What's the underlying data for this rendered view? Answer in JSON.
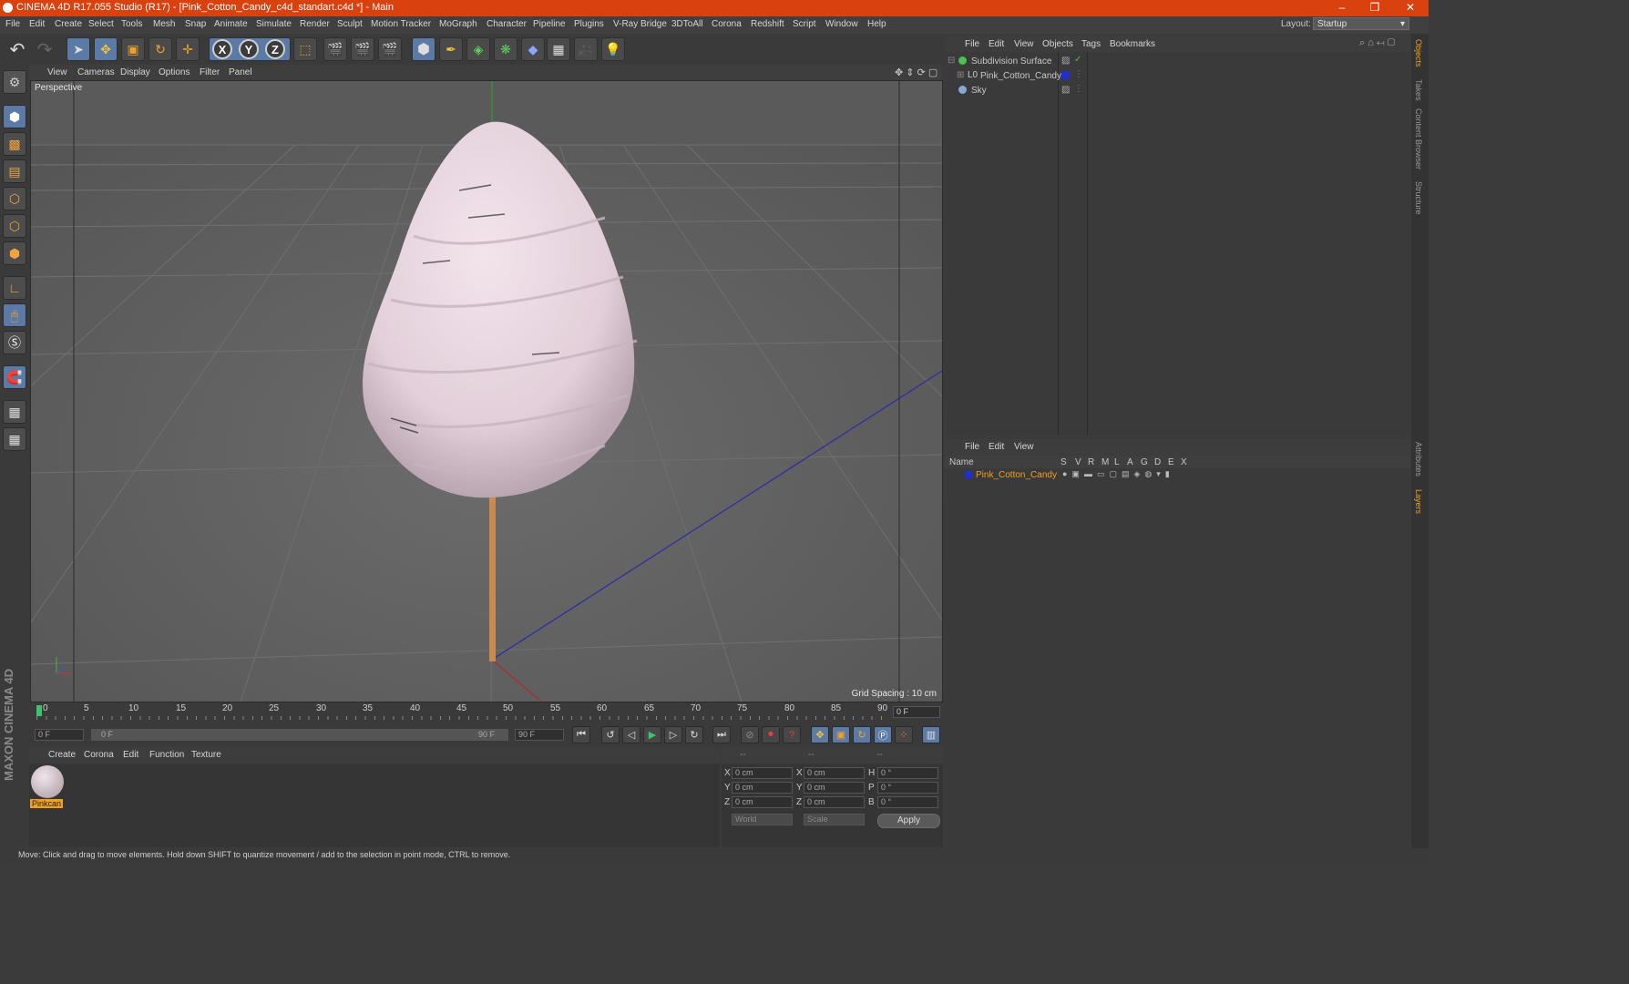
{
  "window": {
    "title": "CINEMA 4D R17.055 Studio (R17) - [Pink_Cotton_Candy_c4d_standart.c4d *] - Main",
    "minimize": "–",
    "restore": "❐",
    "close": "✕"
  },
  "menubar": {
    "items": [
      "File",
      "Edit",
      "Create",
      "Select",
      "Tools",
      "Mesh",
      "Snap",
      "Animate",
      "Simulate",
      "Render",
      "Sculpt",
      "Motion Tracker",
      "MoGraph",
      "Character",
      "Pipeline",
      "Plugins",
      "V-Ray Bridge",
      "3DToAll",
      "Corona",
      "Redshift",
      "Script",
      "Window",
      "Help"
    ],
    "layout_label": "Layout:",
    "layout_value": "Startup"
  },
  "toolbar": {
    "undo": "↶",
    "redo": "↷",
    "x_axis": "X",
    "y_axis": "Y",
    "z_axis": "Z"
  },
  "viewport": {
    "menu": [
      "View",
      "Cameras",
      "Display",
      "Options",
      "Filter",
      "Panel"
    ],
    "label": "Perspective",
    "grid_spacing": "Grid Spacing : 10 cm"
  },
  "timeline": {
    "ticks": [
      "0",
      "5",
      "10",
      "15",
      "20",
      "25",
      "30",
      "35",
      "40",
      "45",
      "50",
      "55",
      "60",
      "65",
      "70",
      "75",
      "80",
      "85",
      "90"
    ],
    "current_frame": "0 F",
    "start_field": "0 F",
    "range_start": "0 F",
    "range_end": "90 F",
    "end_field": "90 F"
  },
  "material_manager": {
    "menu": [
      "Create",
      "Corona",
      "Edit",
      "Function",
      "Texture"
    ],
    "material_name": "Pinkcan"
  },
  "coordinates": {
    "headers": [
      "--",
      "--",
      "--"
    ],
    "rows": [
      {
        "a": "X",
        "av": "0 cm",
        "b": "X",
        "bv": "0 cm",
        "c": "H",
        "cv": "0 °"
      },
      {
        "a": "Y",
        "av": "0 cm",
        "b": "Y",
        "bv": "0 cm",
        "c": "P",
        "cv": "0 °"
      },
      {
        "a": "Z",
        "av": "0 cm",
        "b": "Z",
        "bv": "0 cm",
        "c": "B",
        "cv": "0 °"
      }
    ],
    "world": "World",
    "scale": "Scale",
    "apply": "Apply"
  },
  "object_manager": {
    "menu": [
      "File",
      "Edit",
      "View",
      "Objects",
      "Tags",
      "Bookmarks"
    ],
    "objects": [
      "Subdivision Surface",
      "Pink_Cotton_Candy",
      "Sky"
    ]
  },
  "layer_manager": {
    "menu": [
      "File",
      "Edit",
      "View"
    ],
    "columns": [
      "Name",
      "S",
      "V",
      "R",
      "M",
      "L",
      "A",
      "G",
      "D",
      "E",
      "X"
    ],
    "layers": [
      "Pink_Cotton_Candy"
    ]
  },
  "side_tabs": [
    "Objects",
    "Takes",
    "Content Browser",
    "Structure",
    "Attributes",
    "Layers"
  ],
  "brand": "MAXON CINEMA 4D",
  "status": "Move: Click and drag to move elements. Hold down SHIFT to quantize movement / add to the selection in point mode, CTRL to remove.",
  "colors": {
    "titlebar": "#d9410f",
    "layer_text": "#f0a020",
    "candy": "#e9d6e0",
    "stick": "#c98a4e"
  }
}
